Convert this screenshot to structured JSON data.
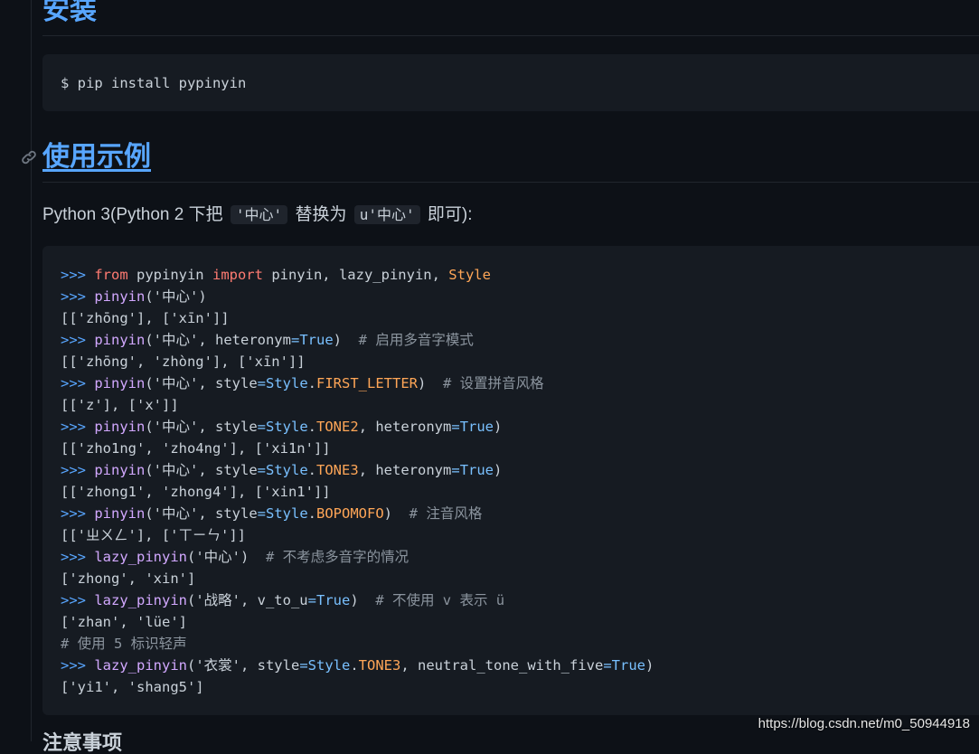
{
  "headings": {
    "install": "安装",
    "usage": "使用示例"
  },
  "install_code": "$ pip install pypinyin",
  "intro": {
    "before": "Python 3(Python 2 下把 ",
    "code1": "'中心'",
    "middle": " 替换为 ",
    "code2": "u'中心'",
    "after": " 即可):"
  },
  "code_lines": [
    [
      [
        "p",
        ">>> "
      ],
      [
        "k",
        "from"
      ],
      [
        "t",
        " pypinyin "
      ],
      [
        "k",
        "import"
      ],
      [
        "t",
        " pinyin, lazy_pinyin, "
      ],
      [
        "o",
        "Style"
      ]
    ],
    [
      [
        "p",
        ">>> "
      ],
      [
        "f",
        "pinyin"
      ],
      [
        "t",
        "('中心')"
      ]
    ],
    [
      [
        "t",
        "[['zhōng'], ['xīn']]"
      ]
    ],
    [
      [
        "p",
        ">>> "
      ],
      [
        "f",
        "pinyin"
      ],
      [
        "t",
        "('中心', heteronym"
      ],
      [
        "e",
        "="
      ],
      [
        "b",
        "True"
      ],
      [
        "t",
        ")  "
      ],
      [
        "c",
        "# 启用多音字模式"
      ]
    ],
    [
      [
        "t",
        "[['zhōng', 'zhòng'], ['xīn']]"
      ]
    ],
    [
      [
        "p",
        ">>> "
      ],
      [
        "f",
        "pinyin"
      ],
      [
        "t",
        "('中心', style"
      ],
      [
        "e",
        "="
      ],
      [
        "b",
        "Style"
      ],
      [
        "t",
        "."
      ],
      [
        "a",
        "FIRST_LETTER"
      ],
      [
        "t",
        ")  "
      ],
      [
        "c",
        "# 设置拼音风格"
      ]
    ],
    [
      [
        "t",
        "[['z'], ['x']]"
      ]
    ],
    [
      [
        "p",
        ">>> "
      ],
      [
        "f",
        "pinyin"
      ],
      [
        "t",
        "('中心', style"
      ],
      [
        "e",
        "="
      ],
      [
        "b",
        "Style"
      ],
      [
        "t",
        "."
      ],
      [
        "a",
        "TONE2"
      ],
      [
        "t",
        ", heteronym"
      ],
      [
        "e",
        "="
      ],
      [
        "b",
        "True"
      ],
      [
        "t",
        ")"
      ]
    ],
    [
      [
        "t",
        "[['zho1ng', 'zho4ng'], ['xi1n']]"
      ]
    ],
    [
      [
        "p",
        ">>> "
      ],
      [
        "f",
        "pinyin"
      ],
      [
        "t",
        "('中心', style"
      ],
      [
        "e",
        "="
      ],
      [
        "b",
        "Style"
      ],
      [
        "t",
        "."
      ],
      [
        "a",
        "TONE3"
      ],
      [
        "t",
        ", heteronym"
      ],
      [
        "e",
        "="
      ],
      [
        "b",
        "True"
      ],
      [
        "t",
        ")"
      ]
    ],
    [
      [
        "t",
        "[['zhong1', 'zhong4'], ['xin1']]"
      ]
    ],
    [
      [
        "p",
        ">>> "
      ],
      [
        "f",
        "pinyin"
      ],
      [
        "t",
        "('中心', style"
      ],
      [
        "e",
        "="
      ],
      [
        "b",
        "Style"
      ],
      [
        "t",
        "."
      ],
      [
        "a",
        "BOPOMOFO"
      ],
      [
        "t",
        ")  "
      ],
      [
        "c",
        "# 注音风格"
      ]
    ],
    [
      [
        "t",
        "[['ㄓㄨㄥ'], ['ㄒㄧㄣ']]"
      ]
    ],
    [
      [
        "p",
        ">>> "
      ],
      [
        "f",
        "lazy_pinyin"
      ],
      [
        "t",
        "('中心')  "
      ],
      [
        "c",
        "# 不考虑多音字的情况"
      ]
    ],
    [
      [
        "t",
        "['zhong', 'xin']"
      ]
    ],
    [
      [
        "p",
        ">>> "
      ],
      [
        "f",
        "lazy_pinyin"
      ],
      [
        "t",
        "('战略', v_to_u"
      ],
      [
        "e",
        "="
      ],
      [
        "b",
        "True"
      ],
      [
        "t",
        ")  "
      ],
      [
        "c",
        "# 不使用 v 表示 ü"
      ]
    ],
    [
      [
        "t",
        "['zhan', 'lüe']"
      ]
    ],
    [
      [
        "c",
        "# 使用 5 标识轻声"
      ]
    ],
    [
      [
        "p",
        ">>> "
      ],
      [
        "f",
        "lazy_pinyin"
      ],
      [
        "t",
        "('衣裳', style"
      ],
      [
        "e",
        "="
      ],
      [
        "b",
        "Style"
      ],
      [
        "t",
        "."
      ],
      [
        "a",
        "TONE3"
      ],
      [
        "t",
        ", neutral_tone_with_five"
      ],
      [
        "e",
        "="
      ],
      [
        "b",
        "True"
      ],
      [
        "t",
        ")"
      ]
    ],
    [
      [
        "t",
        "['yi1', 'shang5']"
      ]
    ]
  ],
  "next_heading_partial": "注意事项",
  "watermark": "https://blog.csdn.net/m0_50944918",
  "colors": {
    "background": "#0d1117",
    "code_background": "#161b22",
    "heading": "#58a6ff",
    "keyword": "#ff7b72",
    "constant": "#ffa657",
    "function": "#d2a8ff",
    "comment": "#8b949e",
    "builtin": "#79c0ff"
  }
}
